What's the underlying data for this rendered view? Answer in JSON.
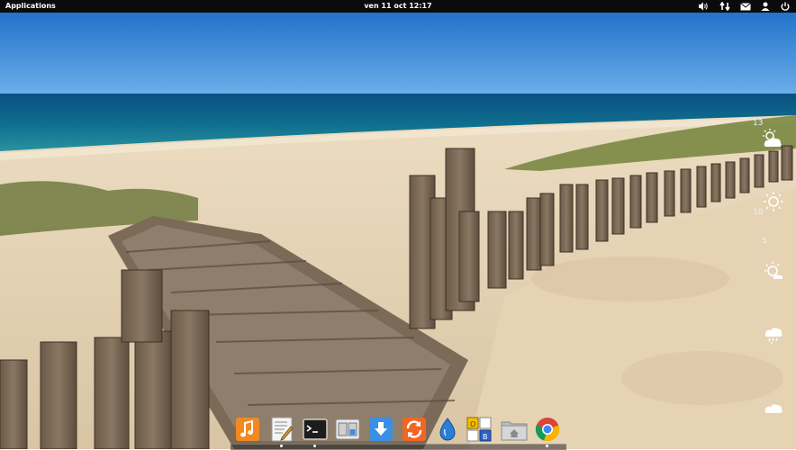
{
  "panel": {
    "applications_label": "Applications",
    "clock": "ven 11 oct 12:17",
    "indicators": [
      "sound-icon",
      "network-icon",
      "mail-icon",
      "user-icon",
      "power-icon"
    ]
  },
  "weather": {
    "temps": [
      "13",
      "10",
      "5"
    ],
    "icons": [
      "partly-cloudy-icon",
      "sunny-icon",
      "sunny-haze-icon",
      "rain-icon",
      "cloud-icon"
    ]
  },
  "dock": {
    "apps": [
      {
        "name": "music-app",
        "icon": "music-note-icon",
        "glyph": "♪",
        "color": "#f28a1e",
        "running": false
      },
      {
        "name": "text-editor-app",
        "icon": "text-editor-icon",
        "glyph": "",
        "color": "#e9e9e9",
        "running": false
      },
      {
        "name": "terminal-app",
        "icon": "terminal-icon",
        "glyph": ">_",
        "color": "#1d1d1d",
        "running": true
      },
      {
        "name": "settings-app",
        "icon": "switchboard-icon",
        "glyph": "",
        "color": "#dcdcdc",
        "running": false
      },
      {
        "name": "software-center-app",
        "icon": "download-arrow-icon",
        "glyph": "⬇",
        "color": "#3a8fe3",
        "running": false
      },
      {
        "name": "update-manager-app",
        "icon": "sync-arrows-icon",
        "glyph": "⟳",
        "color": "#f26522",
        "running": false
      },
      {
        "name": "midori-browser-app",
        "icon": "water-drop-icon",
        "glyph": "",
        "color": "#2a7fd4",
        "running": false
      },
      {
        "name": "office-app",
        "icon": "office-blocks-icon",
        "glyph": "",
        "color": "#f5c000",
        "running": false
      },
      {
        "name": "files-app",
        "icon": "home-folder-icon",
        "glyph": "⌂",
        "color": "#c9c9c9",
        "running": false
      },
      {
        "name": "chrome-app",
        "icon": "chrome-icon",
        "glyph": "",
        "color": "#e53935",
        "running": true
      }
    ]
  },
  "colors": {
    "panel_bg": "#0b0b0b",
    "sky_top": "#1769c7",
    "sea": "#0e6d8a",
    "sand": "#ecdcc1"
  }
}
